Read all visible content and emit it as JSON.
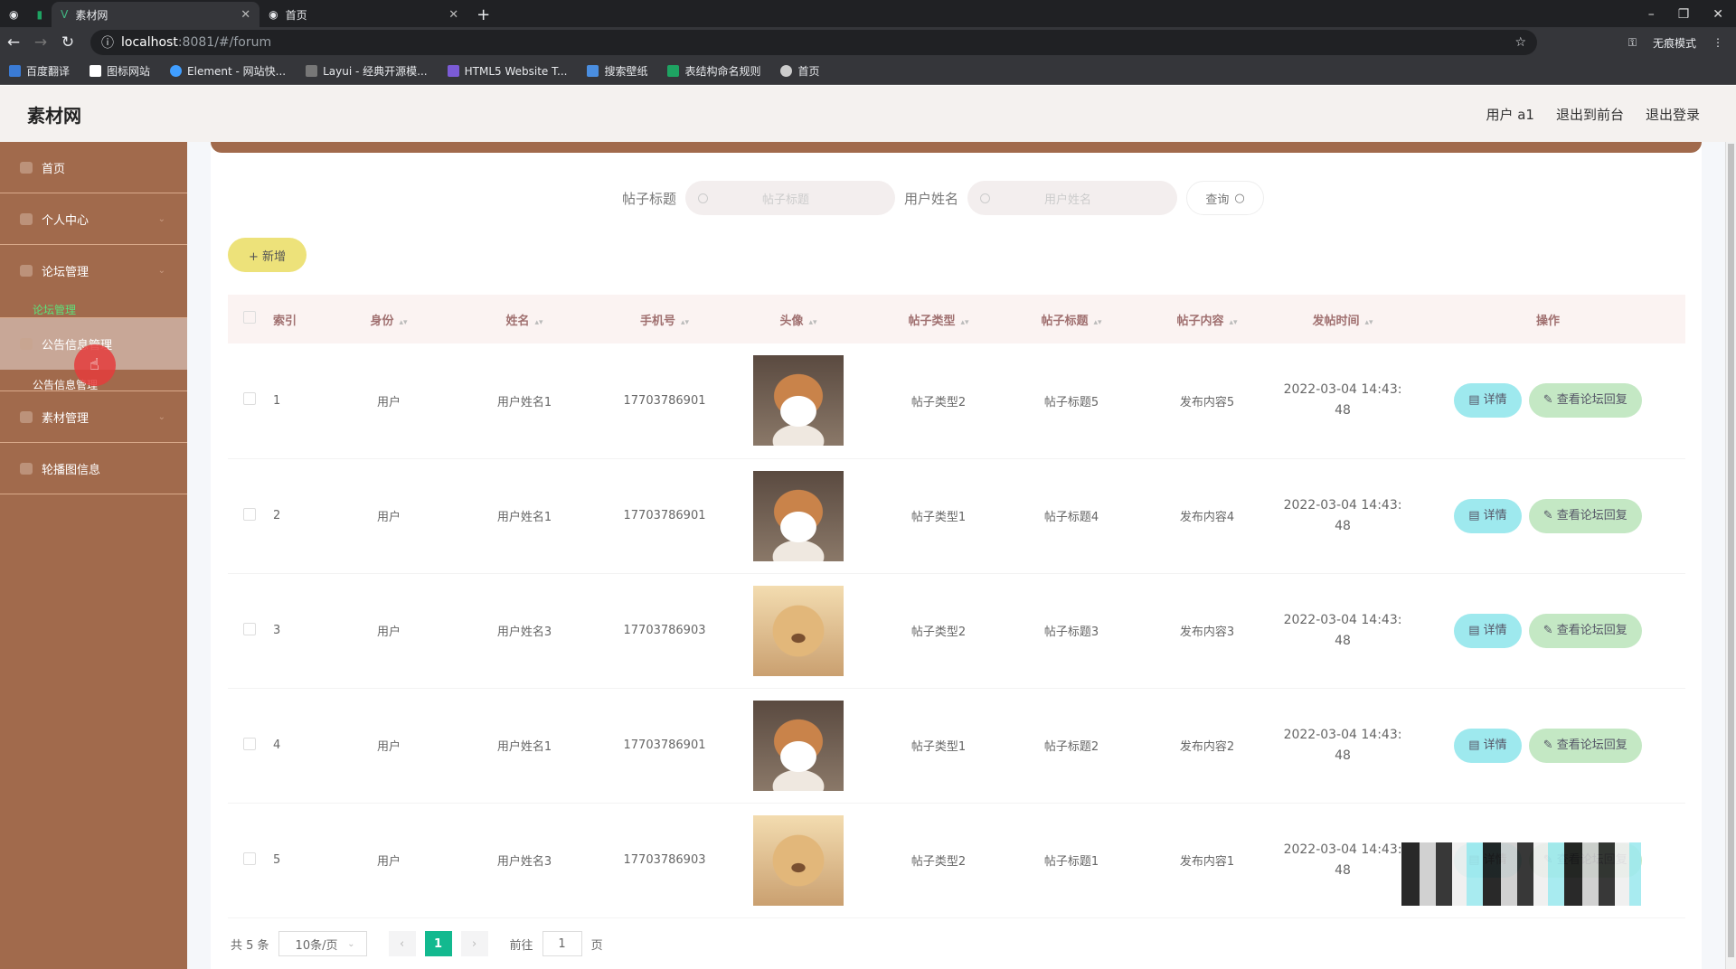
{
  "browser": {
    "tabs": [
      {
        "label": "素材网",
        "icon": "vue-icon"
      },
      {
        "label": "首页",
        "icon": "globe-icon"
      }
    ],
    "url_host": "localhost",
    "url_rest": ":8081/#/forum",
    "incognito_label": "无痕模式",
    "bookmarks": [
      "百度翻译",
      "图标网站",
      "Element - 网站快...",
      "Layui - 经典开源模...",
      "HTML5 Website T...",
      "搜索壁纸",
      "表结构命名规则",
      "首页"
    ]
  },
  "header": {
    "logo": "素材网",
    "user": "用户 a1",
    "to_front": "退出到前台",
    "logout": "退出登录"
  },
  "sidebar": {
    "items": [
      "首页",
      "个人中心",
      "论坛管理",
      "公告信息管理",
      "素材管理",
      "轮播图信息"
    ],
    "subs": [
      "论坛管理",
      "公告信息管理"
    ]
  },
  "search": {
    "title_label": "帖子标题",
    "title_placeholder": "帖子标题",
    "name_label": "用户姓名",
    "name_placeholder": "用户姓名",
    "query": "查询"
  },
  "add_label": "+ 新增",
  "table": {
    "headers": [
      "索引",
      "身份",
      "姓名",
      "手机号",
      "头像",
      "帖子类型",
      "帖子标题",
      "帖子内容",
      "发帖时间",
      "操作"
    ],
    "rows": [
      {
        "idx": "1",
        "role": "用户",
        "name": "用户姓名1",
        "phone": "17703786901",
        "avatar": "shiba",
        "type": "帖子类型2",
        "title": "帖子标题5",
        "content": "发布内容5",
        "time1": "2022-03-04 14:43:",
        "time2": "48"
      },
      {
        "idx": "2",
        "role": "用户",
        "name": "用户姓名1",
        "phone": "17703786901",
        "avatar": "shiba",
        "type": "帖子类型1",
        "title": "帖子标题4",
        "content": "发布内容4",
        "time1": "2022-03-04 14:43:",
        "time2": "48"
      },
      {
        "idx": "3",
        "role": "用户",
        "name": "用户姓名3",
        "phone": "17703786903",
        "avatar": "golden",
        "type": "帖子类型2",
        "title": "帖子标题3",
        "content": "发布内容3",
        "time1": "2022-03-04 14:43:",
        "time2": "48"
      },
      {
        "idx": "4",
        "role": "用户",
        "name": "用户姓名1",
        "phone": "17703786901",
        "avatar": "shiba",
        "type": "帖子类型1",
        "title": "帖子标题2",
        "content": "发布内容2",
        "time1": "2022-03-04 14:43:",
        "time2": "48"
      },
      {
        "idx": "5",
        "role": "用户",
        "name": "用户姓名3",
        "phone": "17703786903",
        "avatar": "golden",
        "type": "帖子类型2",
        "title": "帖子标题1",
        "content": "发布内容1",
        "time1": "2022-03-04 14:43:",
        "time2": "48"
      }
    ],
    "detail": "详情",
    "reply": "查看论坛回复"
  },
  "pager": {
    "total": "共 5 条",
    "size": "10条/页",
    "current": "1",
    "goto": "前往",
    "goto_value": "1",
    "page": "页"
  }
}
